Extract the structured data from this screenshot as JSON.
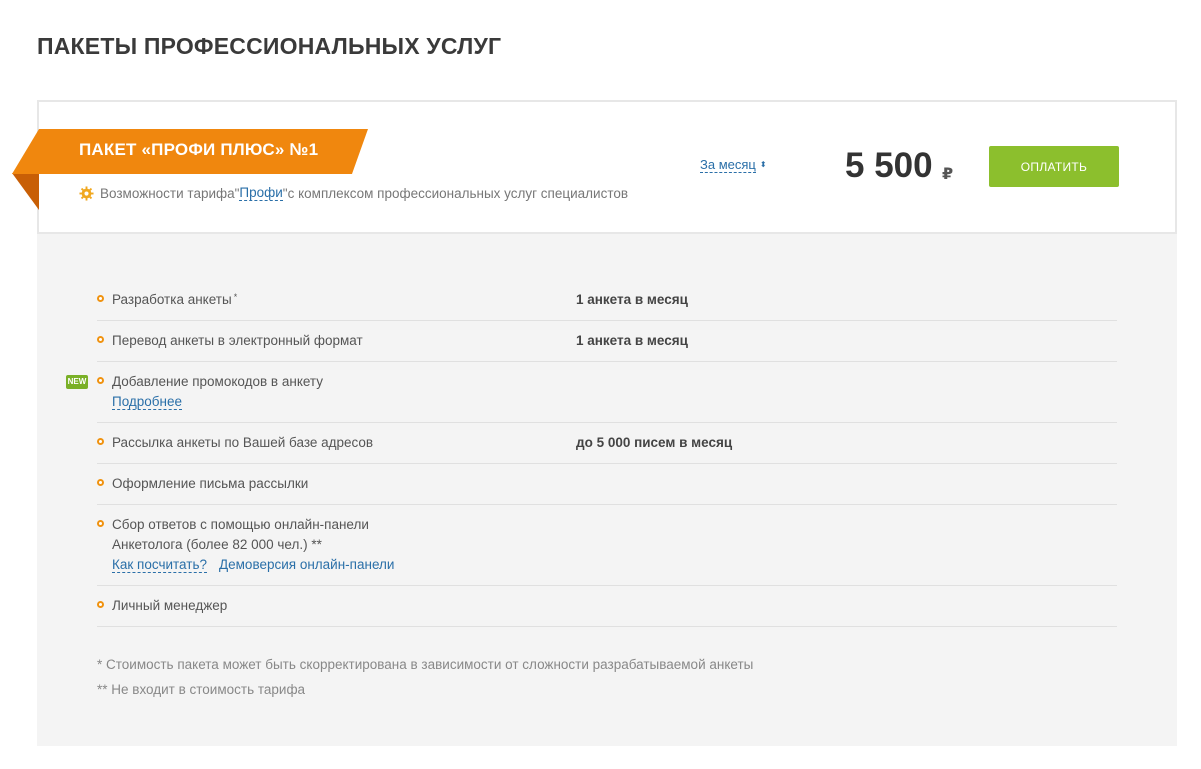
{
  "page": {
    "title": "ПАКЕТЫ ПРОФЕССИОНАЛЬНЫХ УСЛУГ"
  },
  "package": {
    "name": "ПАКЕТ «ПРОФИ ПЛЮС» №1",
    "description_prefix": "Возможности тарифа ",
    "description_open_quote": "\"",
    "description_link": "Профи",
    "description_close_quote": "\"",
    "description_suffix": " с комплексом профессиональных услуг специалистов",
    "period": "За месяц",
    "price": "5 500",
    "currency": "₽",
    "pay_label": "Оплатить",
    "ribbon_color": "#f0870e",
    "button_color": "#8cbf2d"
  },
  "features": [
    {
      "name": "Разработка анкеты",
      "mark": "*",
      "value": "1 анкета в месяц"
    },
    {
      "name": "Перевод анкеты в электронный формат",
      "value": "1 анкета в месяц"
    },
    {
      "name": "Добавление промокодов в анкету",
      "badge": "NEW",
      "link": "Подробнее"
    },
    {
      "name": "Рассылка анкеты по Вашей базе адресов",
      "value": "до 5 000 писем в месяц"
    },
    {
      "name": "Оформление письма рассылки"
    },
    {
      "name_line1": "Сбор ответов с помощью онлайн-панели",
      "name_line2": "Анкетолога (более 82 000 чел.) **",
      "link1": "Как посчитать?",
      "link2": "Демоверсия онлайн-панели"
    },
    {
      "name": "Личный менеджер"
    }
  ],
  "footnotes": {
    "note1": "* Стоимость пакета может быть скорректирована в зависимости от сложности разрабатываемой анкеты",
    "note2": "** Не входит в стоимость тарифа"
  }
}
